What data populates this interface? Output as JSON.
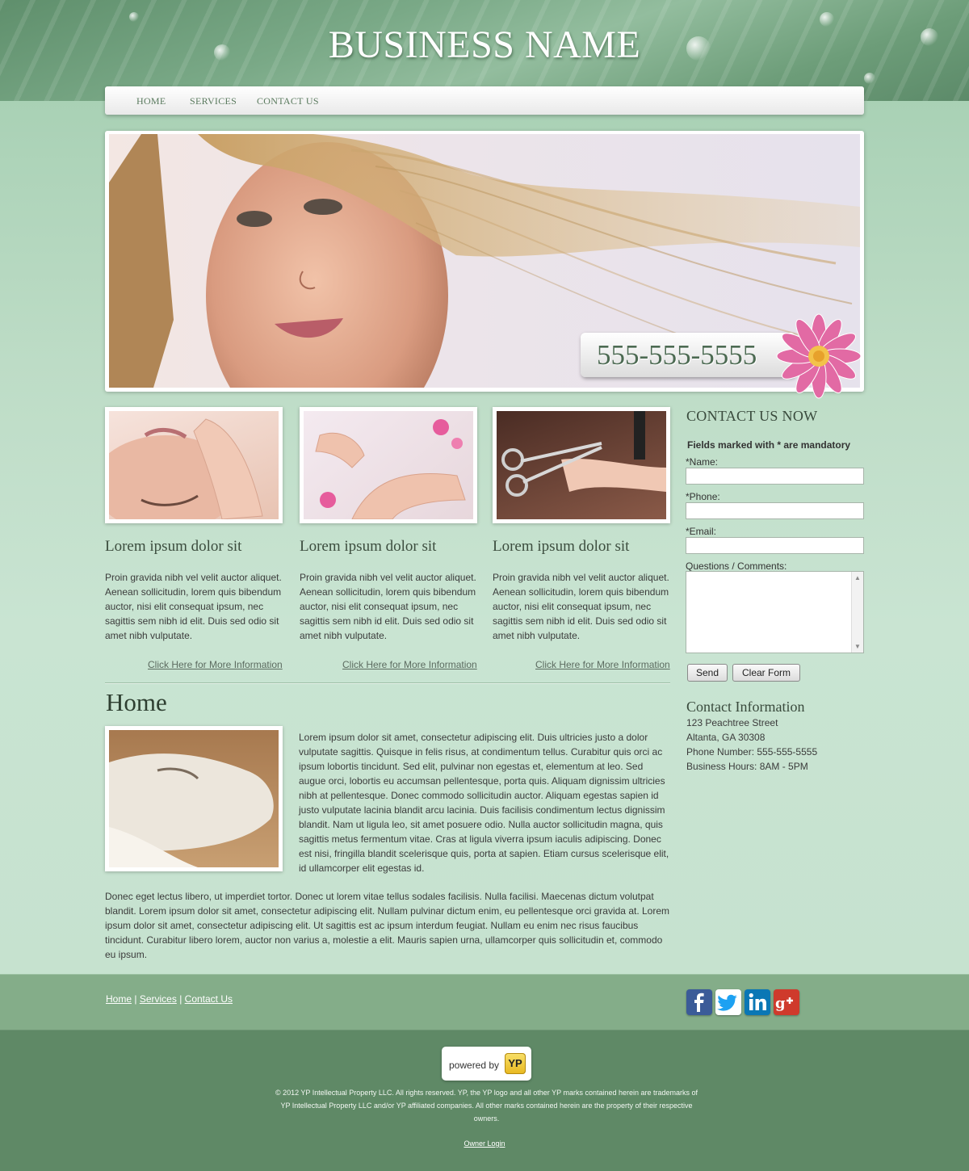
{
  "header": {
    "business_name": "BUSINESS NAME",
    "nav": [
      "HOME",
      "SERVICES",
      "CONTACT US"
    ]
  },
  "hero": {
    "phone": "555-555-5555"
  },
  "features": [
    {
      "heading": "Lorem ipsum dolor sit",
      "text": "Proin gravida nibh vel velit auctor aliquet. Aenean sollicitudin, lorem quis bibendum auctor, nisi elit consequat ipsum, nec sagittis sem nibh id elit. Duis sed odio sit amet nibh vulputate.",
      "link": "Click Here for More Information"
    },
    {
      "heading": "Lorem ipsum dolor sit",
      "text": "Proin gravida nibh vel velit auctor aliquet. Aenean sollicitudin, lorem quis bibendum auctor, nisi elit consequat ipsum, nec sagittis sem nibh id elit. Duis sed odio sit amet nibh vulputate.",
      "link": "Click Here for More Information"
    },
    {
      "heading": "Lorem ipsum dolor sit",
      "text": "Proin gravida nibh vel velit auctor aliquet. Aenean sollicitudin, lorem quis bibendum auctor, nisi elit consequat ipsum, nec sagittis sem nibh id elit. Duis sed odio sit amet nibh vulputate.",
      "link": "Click Here for More Information"
    }
  ],
  "home": {
    "heading": "Home",
    "para1": "Lorem ipsum dolor sit amet, consectetur adipiscing elit. Duis ultricies justo a dolor vulputate sagittis. Quisque in felis risus, at condimentum tellus. Curabitur quis orci ac ipsum lobortis tincidunt. Sed elit, pulvinar non egestas et, elementum at leo. Sed augue orci, lobortis eu accumsan pellentesque, porta quis. Aliquam dignissim ultricies nibh at pellentesque. Donec commodo sollicitudin auctor. Aliquam egestas sapien id justo vulputate lacinia blandit arcu lacinia. Duis facilisis condimentum lectus dignissim blandit. Nam ut ligula leo, sit amet posuere odio. Nulla auctor sollicitudin magna, quis sagittis metus fermentum vitae. Cras at ligula viverra ipsum iaculis adipiscing. Donec est nisi, fringilla blandit scelerisque quis, porta at sapien. Etiam cursus scelerisque elit, id ullamcorper elit egestas id.",
    "para2": "Donec eget lectus libero, ut imperdiet tortor. Donec ut lorem vitae tellus sodales facilisis. Nulla facilisi. Maecenas dictum volutpat blandit. Lorem ipsum dolor sit amet, consectetur adipiscing elit. Nullam pulvinar dictum enim, eu pellentesque orci gravida at. Lorem ipsum dolor sit amet, consectetur adipiscing elit. Ut sagittis est ac ipsum interdum feugiat. Nullam eu enim nec risus faucibus tincidunt. Curabitur libero lorem, auctor non varius a, molestie a elit. Mauris sapien urna, ullamcorper quis sollicitudin et, commodo eu ipsum."
  },
  "contact_form": {
    "heading": "CONTACT US NOW",
    "mandatory_note": "Fields marked with * are mandatory",
    "name_label": "*Name:",
    "name_value": "",
    "phone_label": "*Phone:",
    "phone_value": "",
    "email_label": "*Email:",
    "email_value": "",
    "comments_label": "Questions / Comments:",
    "comments_value": "",
    "send_label": "Send",
    "clear_label": "Clear Form"
  },
  "contact_info": {
    "heading": "Contact Information",
    "street": "123 Peachtree Street",
    "city": "Altanta, GA 30308",
    "phone": "Phone Number: 555-555-5555",
    "hours": "Business Hours: 8AM - 5PM"
  },
  "footer": {
    "links": [
      "Home",
      "Services",
      "Contact Us"
    ],
    "separator": "|",
    "social": [
      "facebook-icon",
      "twitter-icon",
      "linkedin-icon",
      "google-plus-icon"
    ],
    "powered_by": "powered by",
    "yp_logo": "YP",
    "copyright": "© 2012  YP Intellectual Property LLC. All rights reserved. YP, the YP logo and all other YP marks contained herein are trademarks of YP Intellectual Property LLC and/or YP affiliated companies. All other marks contained herein are the property of their respective owners.",
    "owner_login": "Owner Login"
  },
  "colors": {
    "header_green": "#7aa987",
    "page_green": "#c9e4d2",
    "footer_green": "#84ad89",
    "footer_dark": "#5f8966",
    "phone_text": "#4c6a52"
  }
}
